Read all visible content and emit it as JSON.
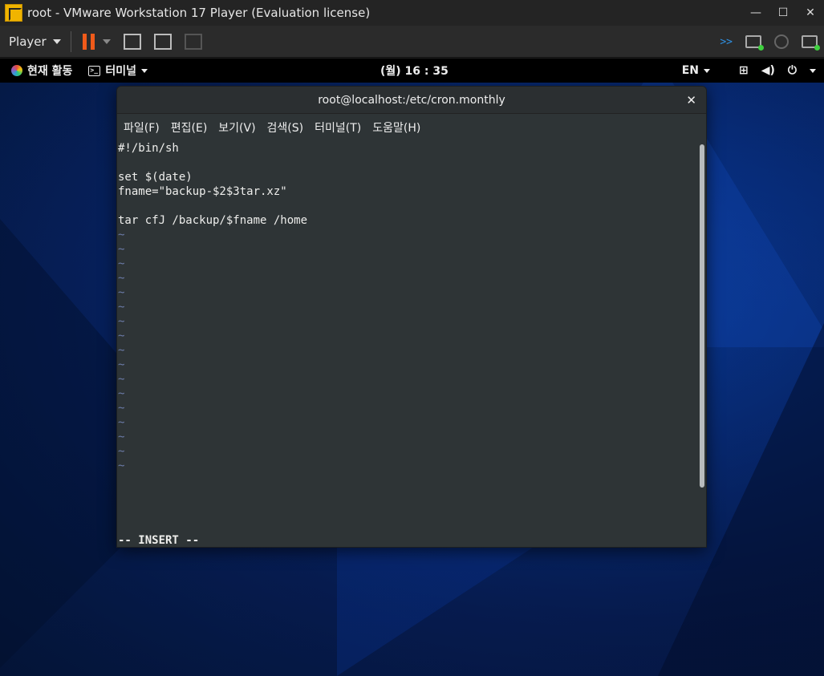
{
  "vmware": {
    "title": "root - VMware Workstation 17 Player (Evaluation license)",
    "player_menu": "Player",
    "window_controls": [
      "—",
      "☐",
      "✕"
    ]
  },
  "gnome": {
    "activities": "현재 활동",
    "app_menu": "터미널",
    "clock": "(월) 16 : 35",
    "lang": "EN"
  },
  "terminal": {
    "title": "root@localhost:/etc/cron.monthly",
    "menus": [
      "파일(F)",
      "편집(E)",
      "보기(V)",
      "검색(S)",
      "터미널(T)",
      "도움말(H)"
    ],
    "lines": [
      "#!/bin/sh",
      "",
      "set $(date)",
      "fname=\"backup-$2$3tar.xz\"",
      "",
      "tar cfJ /backup/$fname /home"
    ],
    "tilde_count": 17,
    "tilde": "~",
    "status": "-- INSERT --"
  }
}
